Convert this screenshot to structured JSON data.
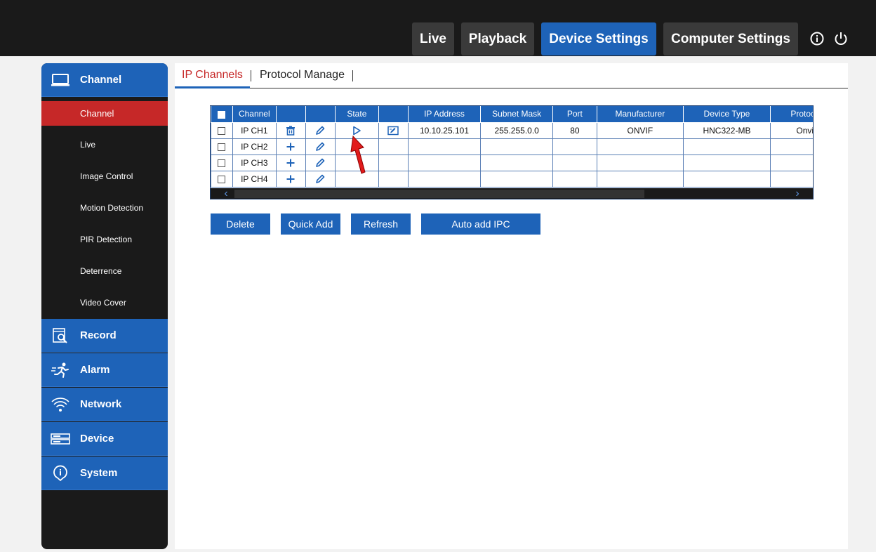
{
  "top_nav": {
    "live": "Live",
    "playback": "Playback",
    "device_settings": "Device Settings",
    "computer_settings": "Computer Settings"
  },
  "sidebar": {
    "sections": [
      {
        "label": "Channel",
        "icon": "monitor-icon"
      },
      {
        "label": "Record",
        "icon": "record-search-icon"
      },
      {
        "label": "Alarm",
        "icon": "running-person-icon"
      },
      {
        "label": "Network",
        "icon": "wifi-icon"
      },
      {
        "label": "Device",
        "icon": "device-icon"
      },
      {
        "label": "System",
        "icon": "info-icon"
      }
    ],
    "channel_items": [
      "Channel",
      "Live",
      "Image Control",
      "Motion Detection",
      "PIR Detection",
      "Deterrence",
      "Video Cover"
    ],
    "active_item": "Channel"
  },
  "tabs": [
    "IP Channels",
    "Protocol Manage"
  ],
  "table": {
    "headers": [
      "Channel",
      "",
      "",
      "State",
      "",
      "IP Address",
      "Subnet Mask",
      "Port",
      "Manufacturer",
      "Device Type",
      "Protocol"
    ],
    "rows": [
      {
        "channel": "IP CH1",
        "action_icon": "trash-icon",
        "state_icon": "play-icon",
        "ip": "10.10.25.101",
        "mask": "255.255.0.0",
        "port": "80",
        "manufacturer": "ONVIF",
        "device_type": "HNC322-MB",
        "protocol": "Onvif"
      },
      {
        "channel": "IP CH2",
        "action_icon": "plus-icon",
        "ip": "",
        "mask": "",
        "port": "",
        "manufacturer": "",
        "device_type": "",
        "protocol": ""
      },
      {
        "channel": "IP CH3",
        "action_icon": "plus-icon",
        "ip": "",
        "mask": "",
        "port": "",
        "manufacturer": "",
        "device_type": "",
        "protocol": ""
      },
      {
        "channel": "IP CH4",
        "action_icon": "plus-icon",
        "ip": "",
        "mask": "",
        "port": "",
        "manufacturer": "",
        "device_type": "",
        "protocol": ""
      }
    ]
  },
  "buttons": {
    "delete": "Delete",
    "quick_add": "Quick Add",
    "refresh": "Refresh",
    "auto_add": "Auto add IPC"
  },
  "colors": {
    "accent": "#1e63b8",
    "active_red": "#c62828",
    "dark_bg": "#1a1a1a"
  }
}
